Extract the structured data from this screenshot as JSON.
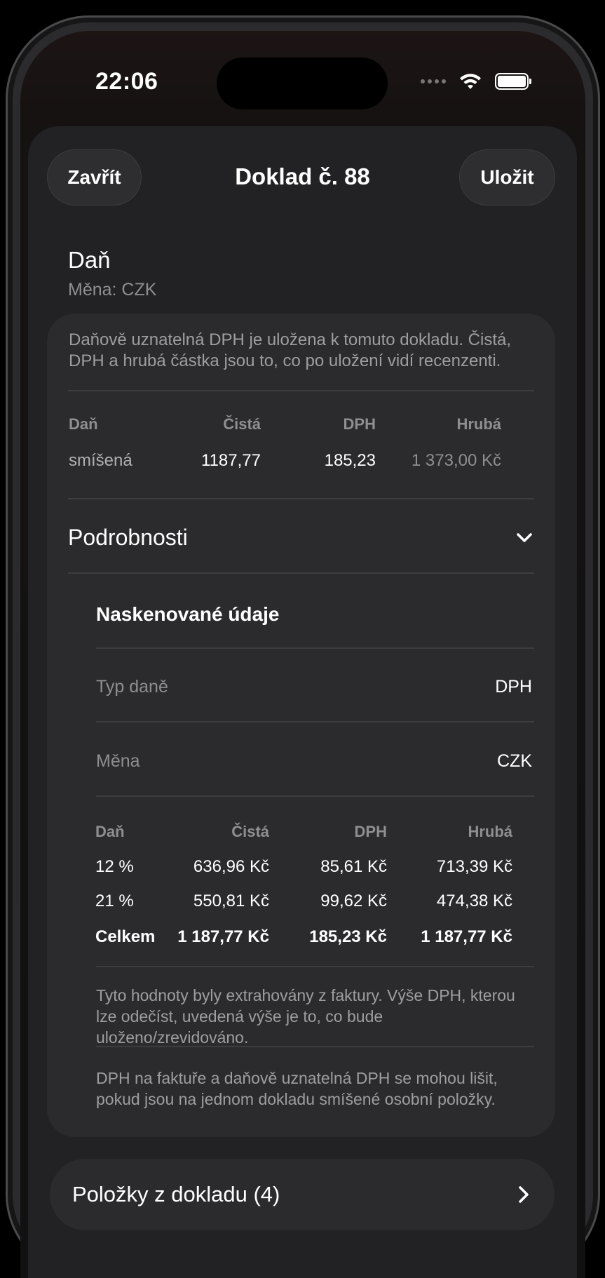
{
  "status": {
    "time": "22:06"
  },
  "nav": {
    "close": "Zavřít",
    "title": "Doklad č. 88",
    "save": "Uložit"
  },
  "tax_section": {
    "title": "Daň",
    "currency_line": "Měna: CZK",
    "intro": "Daňově uznatelná DPH je uložena k tomuto dokladu. Čistá, DPH a hrubá částka jsou to, co po uložení vidí recenzenti.",
    "headers": [
      "Daň",
      "Čistá",
      "DPH",
      "Hrubá"
    ],
    "row": [
      "smíšená",
      "1187,77",
      "185,23",
      "1 373,00 Kč"
    ]
  },
  "details": {
    "label": "Podrobnosti",
    "scanned_title": "Naskenované údaje",
    "tax_type": {
      "key": "Typ daně",
      "value": "DPH"
    },
    "currency": {
      "key": "Měna",
      "value": "CZK"
    },
    "headers": [
      "Daň",
      "Čistá",
      "DPH",
      "Hrubá"
    ],
    "rows": [
      [
        "12 %",
        "636,96 Kč",
        "85,61 Kč",
        "713,39 Kč"
      ],
      [
        "21 %",
        "550,81 Kč",
        "99,62 Kč",
        "474,38 Kč"
      ]
    ],
    "total": [
      "Celkem",
      "1 187,77 Kč",
      "185,23 Kč",
      "1 187,77 Kč"
    ],
    "note1": "Tyto hodnoty byly extrahovány z faktury. Výše DPH, kterou lze odečíst, uvedená výše je to, co bude uloženo/zrevidováno.",
    "note2": "DPH na faktuře a daňově uznatelná DPH se mohou lišit, pokud jsou na jednom dokladu smíšené osobní položky."
  },
  "items": {
    "label": "Položky z dokladu (4)"
  }
}
